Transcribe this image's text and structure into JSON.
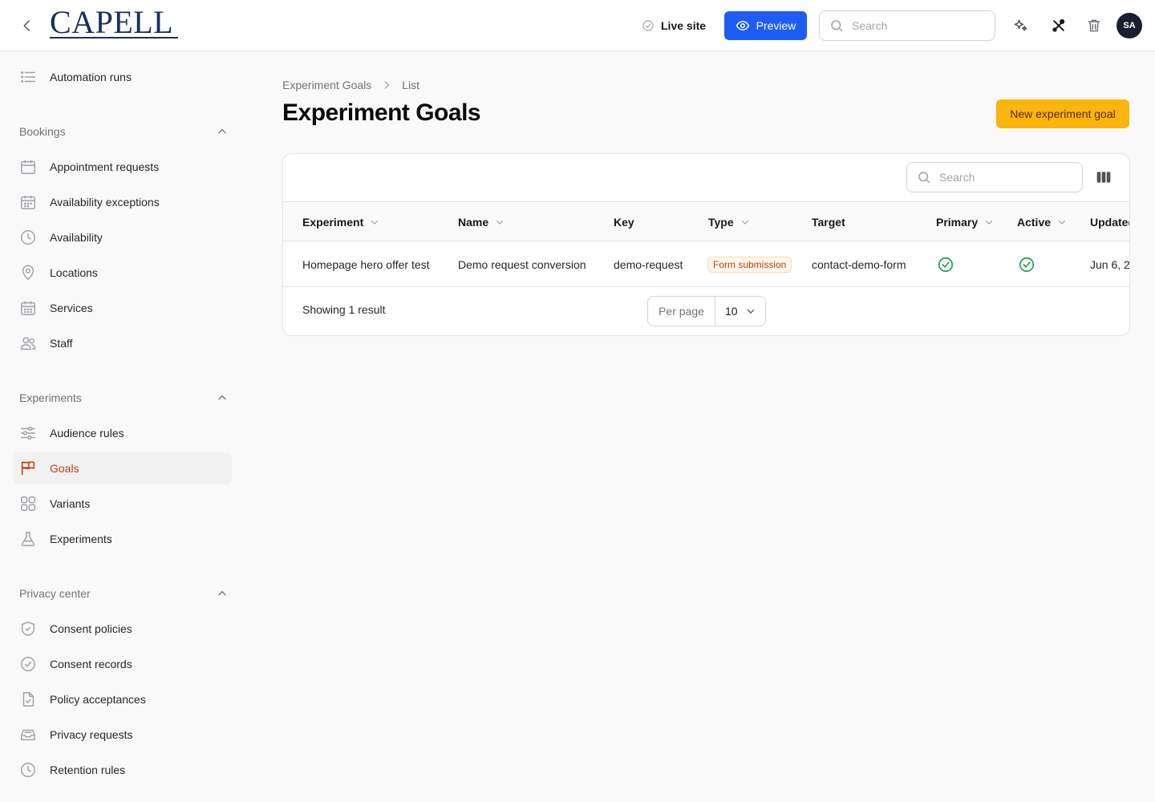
{
  "header": {
    "logo_text": "CAPELL",
    "live_site_label": "Live site",
    "preview_label": "Preview",
    "search_placeholder": "Search",
    "avatar_initials": "SA",
    "preview_color": "#1d5cf5"
  },
  "sidebar": {
    "top_items": [
      {
        "label": "Automation runs",
        "icon": "list-icon"
      }
    ],
    "groups": [
      {
        "label": "Bookings",
        "items": [
          {
            "label": "Appointment requests",
            "icon": "calendar-icon"
          },
          {
            "label": "Availability exceptions",
            "icon": "calendar-grid-icon"
          },
          {
            "label": "Availability",
            "icon": "clock-icon"
          },
          {
            "label": "Locations",
            "icon": "map-pin-icon"
          },
          {
            "label": "Services",
            "icon": "calendar-grid-icon"
          },
          {
            "label": "Staff",
            "icon": "users-icon"
          }
        ]
      },
      {
        "label": "Experiments",
        "items": [
          {
            "label": "Audience rules",
            "icon": "sliders-icon"
          },
          {
            "label": "Goals",
            "icon": "flag-icon",
            "active": true
          },
          {
            "label": "Variants",
            "icon": "squares-icon"
          },
          {
            "label": "Experiments",
            "icon": "beaker-icon"
          }
        ]
      },
      {
        "label": "Privacy center",
        "items": [
          {
            "label": "Consent policies",
            "icon": "shield-check-icon"
          },
          {
            "label": "Consent records",
            "icon": "check-circle-icon"
          },
          {
            "label": "Policy acceptances",
            "icon": "document-check-icon"
          },
          {
            "label": "Privacy requests",
            "icon": "inbox-icon"
          },
          {
            "label": "Retention rules",
            "icon": "clock-icon"
          }
        ]
      }
    ],
    "active_color": "#c2410c"
  },
  "main": {
    "breadcrumb": [
      "Experiment Goals",
      "List"
    ],
    "title": "Experiment Goals",
    "new_button_label": "New experiment goal",
    "new_button_color": "#fbb50b",
    "table": {
      "search_placeholder": "Search",
      "columns": [
        {
          "label": "Experiment",
          "sortable": true
        },
        {
          "label": "Name",
          "sortable": true
        },
        {
          "label": "Key",
          "sortable": false
        },
        {
          "label": "Type",
          "sortable": true
        },
        {
          "label": "Target",
          "sortable": false
        },
        {
          "label": "Primary",
          "sortable": true
        },
        {
          "label": "Active",
          "sortable": true
        },
        {
          "label": "Updated",
          "sortable": true
        }
      ],
      "rows": [
        {
          "experiment": "Homepage hero offer test",
          "name": "Demo request conversion",
          "key": "demo-request",
          "type": "Form submission",
          "target": "contact-demo-form",
          "primary": true,
          "active": true,
          "updated": "Jun 6, 2"
        }
      ],
      "showing_text": "Showing 1 result",
      "per_page_label": "Per page",
      "per_page_value": "10"
    }
  }
}
